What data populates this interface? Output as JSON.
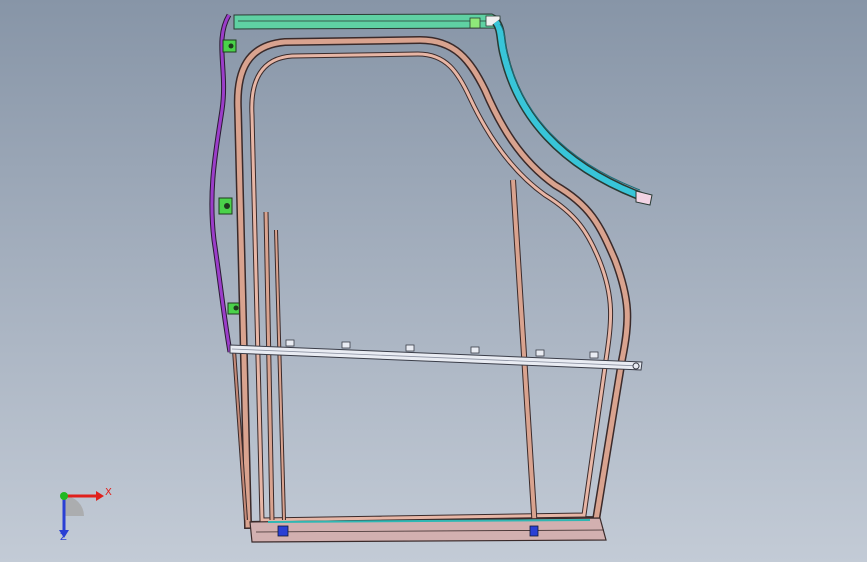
{
  "viewport": {
    "background_top": "#8795a7",
    "background_bottom": "#c3cbd6"
  },
  "colors": {
    "frame_outline": "#3a2a2a",
    "frame_fill": "#d9a38f",
    "top_rail": "#5fd1a3",
    "glass_run": "#38c5d8",
    "seal_strip": "#9b3dc9",
    "brackets": "#4ad24a",
    "beam": "#e9ecf3",
    "bottom_trim": "#2fb7b3",
    "x_axis": "#e0201c",
    "y_axis": "#21b821",
    "z_axis": "#2a3fd4"
  },
  "triad": {
    "x_label": "X",
    "z_label": "Z"
  }
}
